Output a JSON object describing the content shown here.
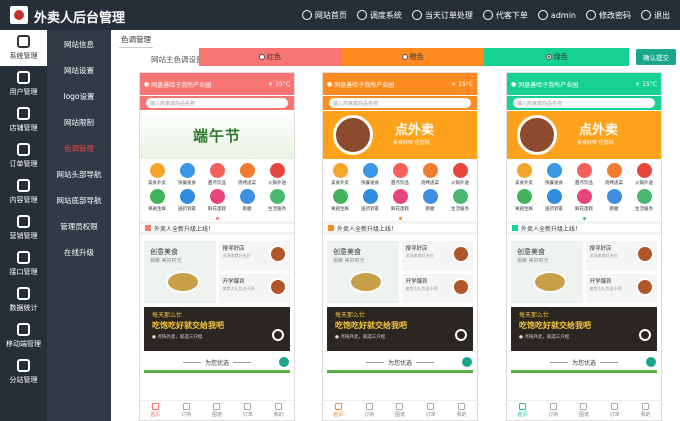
{
  "app": {
    "title": "外卖人后台管理"
  },
  "topnav": [
    {
      "label": "网站首页",
      "icon": "home-icon"
    },
    {
      "label": "调度系统",
      "icon": "dispatch-icon"
    },
    {
      "label": "当天订单处理",
      "icon": "orders-icon"
    },
    {
      "label": "代客下单",
      "icon": "proxy-order-icon"
    },
    {
      "label": "admin",
      "icon": "user-icon"
    },
    {
      "label": "修改密码",
      "icon": "password-icon"
    },
    {
      "label": "退出",
      "icon": "logout-icon"
    }
  ],
  "sidebar1": [
    {
      "label": "系统管理",
      "icon": "system-icon",
      "active": true
    },
    {
      "label": "用户管理",
      "icon": "users-icon"
    },
    {
      "label": "店铺管理",
      "icon": "store-icon"
    },
    {
      "label": "订单管理",
      "icon": "order-icon"
    },
    {
      "label": "内容管理",
      "icon": "content-icon"
    },
    {
      "label": "营销管理",
      "icon": "marketing-icon"
    },
    {
      "label": "接口管理",
      "icon": "api-icon"
    },
    {
      "label": "数据统计",
      "icon": "stats-icon"
    },
    {
      "label": "移动端管理",
      "icon": "mobile-icon"
    },
    {
      "label": "分站管理",
      "icon": "branch-icon"
    }
  ],
  "sidebar2": [
    {
      "label": "网站信息"
    },
    {
      "label": "网站设置"
    },
    {
      "label": "logo设置"
    },
    {
      "label": "网站限制"
    },
    {
      "label": "色调管理",
      "active": true
    },
    {
      "label": "网站头部导航"
    },
    {
      "label": "网站底部导航"
    },
    {
      "label": "管理员权限"
    },
    {
      "label": "在线升级"
    }
  ],
  "main": {
    "tab": "色调管理",
    "color_label": "网站主色调设置",
    "options": [
      {
        "label": "红色",
        "color": "#f77573",
        "checked": false
      },
      {
        "label": "橙色",
        "color": "#ff8a20",
        "checked": false
      },
      {
        "label": "绿色",
        "color": "#16d18f",
        "checked": true
      }
    ],
    "confirm": "确认提交"
  },
  "preview": {
    "location": "同盘善哈子我所产业园",
    "temp": "15°C",
    "search_placeholder": "输入商家或商品名称",
    "banner_text": "端午节",
    "banner2_text": "点外卖",
    "banner2_sub": "美食好味 任您挑",
    "categories": [
      "美食外卖",
      "快餐速食",
      "甜点饮品",
      "烧烤卤菜",
      "火锅外送",
      "果蔬生鲜",
      "送药到家",
      "鲜花蛋糕",
      "跑腿",
      "生活服务"
    ],
    "category_colors": [
      "#f7a42a",
      "#3a97e8",
      "#f5605a",
      "#f07c30",
      "#e8453c",
      "#41b35a",
      "#2e8de0",
      "#e6467a",
      "#3f8fe0",
      "#49b86f"
    ],
    "notice": "外卖人全新升级上线！",
    "promo_title": "创意美食",
    "promo_sub": "相聚 美好时光",
    "promo_r1_title": "搜寻好店",
    "promo_r1_sub": "发现美食好去处",
    "promo_r2_title": "开学爆到",
    "promo_r2_sub": "美食大礼包送不停",
    "dark_t1": "每天那么忙",
    "dark_t2": "吃饱吃好就交给我吧",
    "dark_t3": "● 点快外卖，就选三只松",
    "recommend": "为您优选",
    "tabbar": [
      "首页",
      "订购",
      "图谱",
      "订单",
      "我的"
    ]
  }
}
